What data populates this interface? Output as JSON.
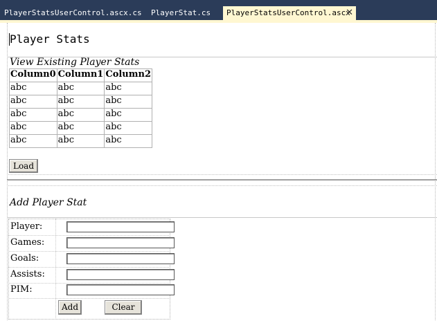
{
  "tabs": [
    {
      "label": "PlayerStatsUserControl.ascx.cs"
    },
    {
      "label": "PlayerStat.cs"
    },
    {
      "label": "PlayerStatsUserControl.ascx",
      "close": "✕"
    }
  ],
  "page": {
    "title": "Player Stats"
  },
  "view_section": {
    "title": "View Existing Player Stats",
    "columns": [
      "Column0",
      "Column1",
      "Column2"
    ],
    "rows": [
      [
        "abc",
        "abc",
        "abc"
      ],
      [
        "abc",
        "abc",
        "abc"
      ],
      [
        "abc",
        "abc",
        "abc"
      ],
      [
        "abc",
        "abc",
        "abc"
      ],
      [
        "abc",
        "abc",
        "abc"
      ]
    ],
    "load_label": "Load"
  },
  "add_section": {
    "title": "Add Player Stat",
    "fields": [
      {
        "label": "Player:",
        "value": ""
      },
      {
        "label": "Games:",
        "value": ""
      },
      {
        "label": "Goals:",
        "value": ""
      },
      {
        "label": "Assists:",
        "value": ""
      },
      {
        "label": "PIM:",
        "value": ""
      }
    ],
    "add_label": "Add",
    "clear_label": "Clear"
  }
}
